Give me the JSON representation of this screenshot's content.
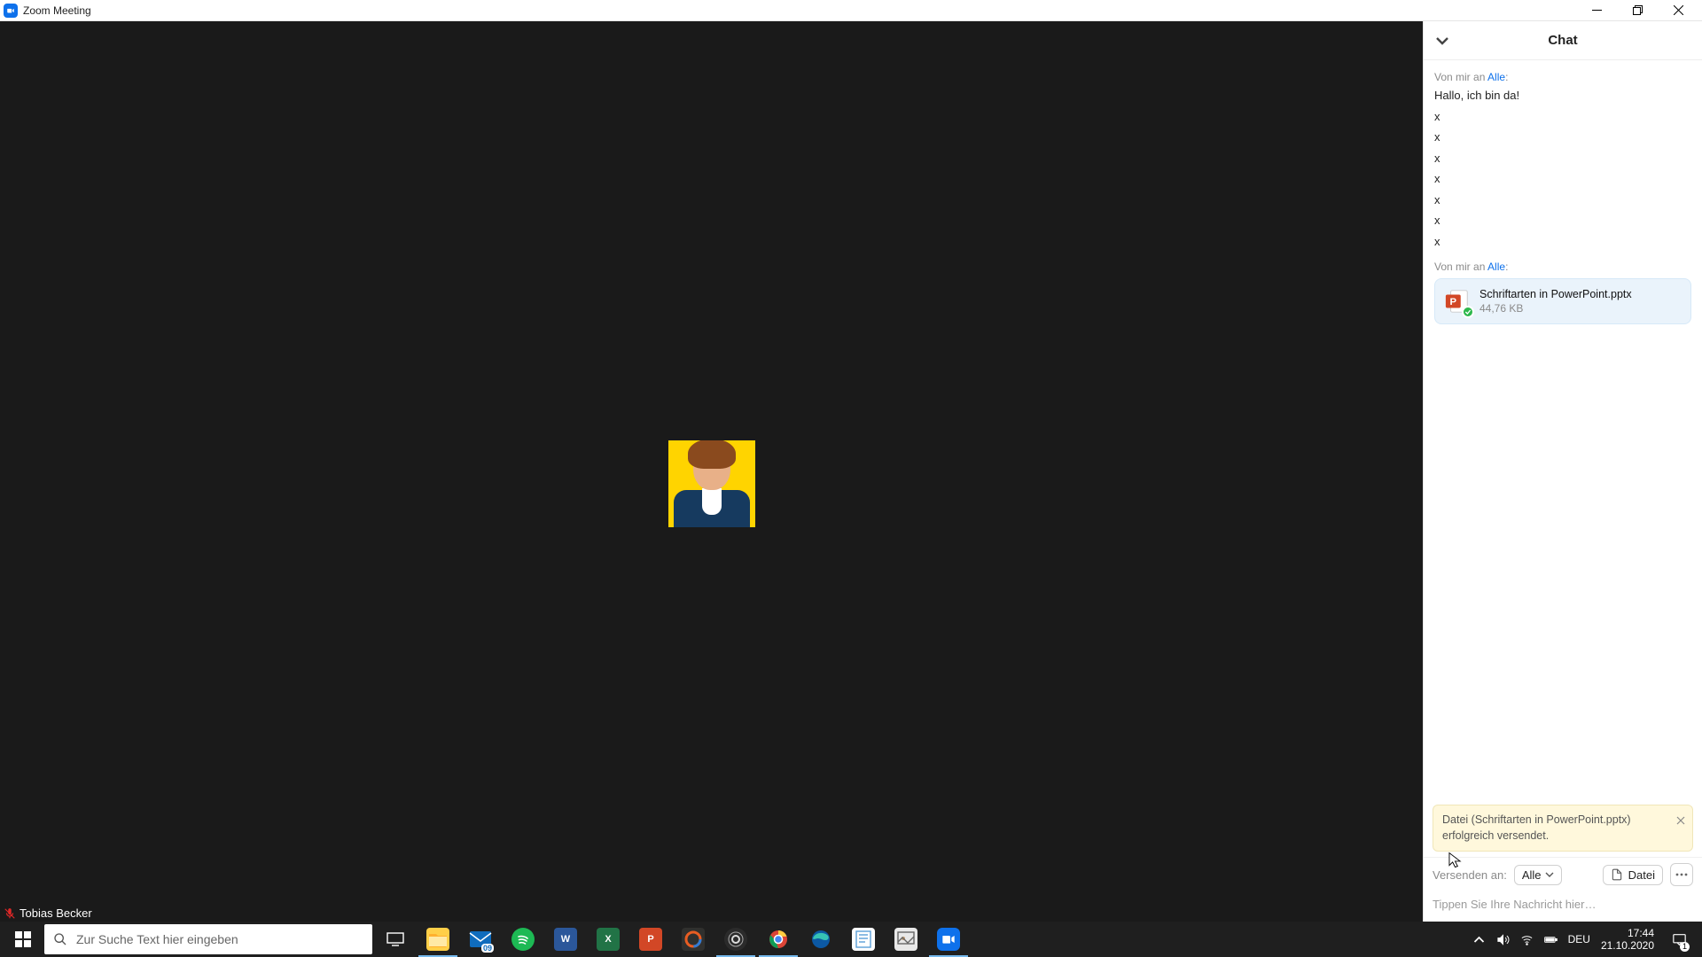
{
  "window": {
    "title": "Zoom Meeting"
  },
  "participant": {
    "name": "Tobias Becker"
  },
  "chat": {
    "header_title": "Chat",
    "metaFrom1_prefix": "Von mir an ",
    "metaFrom1_recipient": "Alle",
    "metaFrom1_suffix": ":",
    "msg1": "Hallo, ich bin da!",
    "x1": "x",
    "x2": "x",
    "x3": "x",
    "x4": "x",
    "x5": "x",
    "x6": "x",
    "x7": "x",
    "metaFrom2_prefix": "Von mir an ",
    "metaFrom2_recipient": "Alle",
    "metaFrom2_suffix": ":",
    "file_name": "Schriftarten in PowerPoint.pptx",
    "file_size": "44,76 KB",
    "toast_text": "Datei (Schriftarten in PowerPoint.pptx) erfolgreich versendet.",
    "send_to_label": "Versenden an:",
    "send_to_value": "Alle",
    "file_button": "Datei",
    "compose_placeholder": "Tippen Sie Ihre Nachricht hier…"
  },
  "taskbar": {
    "search_placeholder": "Zur Suche Text hier eingeben",
    "lang": "DEU",
    "time": "17:44",
    "date": "21.10.2020",
    "calendar_badge": "09",
    "notif_badge": "1"
  }
}
